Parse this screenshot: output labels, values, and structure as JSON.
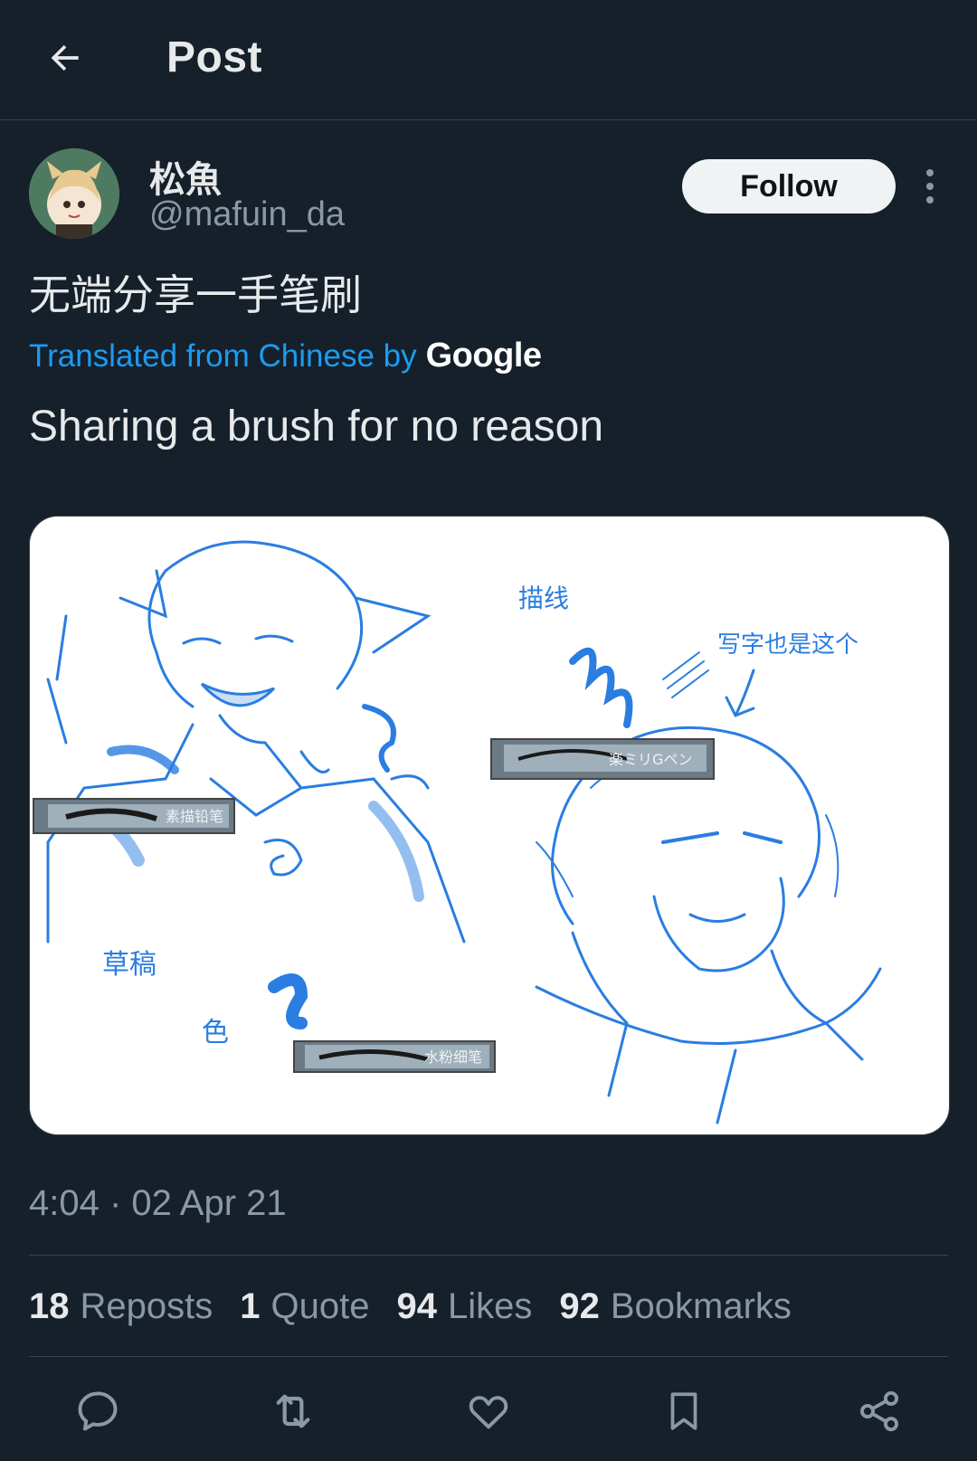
{
  "header": {
    "title": "Post",
    "back_icon": "arrow-left-icon"
  },
  "author": {
    "display_name": "松魚",
    "handle": "@mafuin_da",
    "follow_label": "Follow",
    "more_icon": "more-vertical-icon"
  },
  "post": {
    "text": "无端分享一手笔刷",
    "translated_label": "Translated from Chinese by",
    "translation_provider": "Google",
    "translation": "Sharing a brush for no reason"
  },
  "media": {
    "labels": {
      "line_art": "描线",
      "sketch_too": "写字也是这个",
      "draft": "草稿",
      "color": "色"
    },
    "brushes": [
      "素描铅笔",
      "楽ミリGペン",
      "水粉细笔"
    ]
  },
  "meta": {
    "timestamp": "4:04 · 02 Apr 21"
  },
  "stats": [
    {
      "count": "18",
      "label": "Reposts"
    },
    {
      "count": "1",
      "label": "Quote"
    },
    {
      "count": "94",
      "label": "Likes"
    },
    {
      "count": "92",
      "label": "Bookmarks"
    }
  ],
  "actions": [
    "reply-icon",
    "repost-icon",
    "like-icon",
    "bookmark-icon",
    "share-icon"
  ],
  "colors": {
    "background": "#15202b",
    "accent": "#1d9bf0",
    "muted": "#8b98a5",
    "text": "#e7e9ea",
    "sketch_blue": "#2a7de1"
  }
}
